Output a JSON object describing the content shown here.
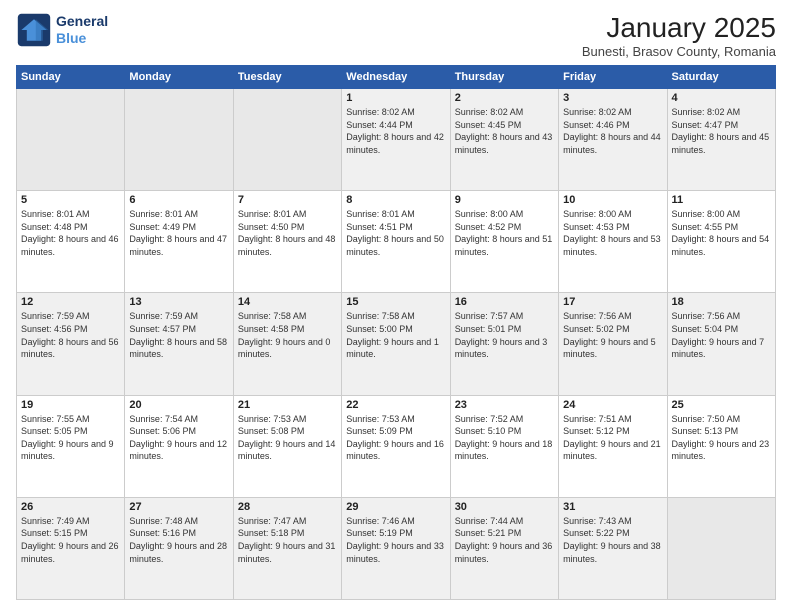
{
  "header": {
    "logo_line1": "General",
    "logo_line2": "Blue",
    "month": "January 2025",
    "location": "Bunesti, Brasov County, Romania"
  },
  "weekdays": [
    "Sunday",
    "Monday",
    "Tuesday",
    "Wednesday",
    "Thursday",
    "Friday",
    "Saturday"
  ],
  "weeks": [
    [
      {
        "day": "",
        "info": ""
      },
      {
        "day": "",
        "info": ""
      },
      {
        "day": "",
        "info": ""
      },
      {
        "day": "1",
        "info": "Sunrise: 8:02 AM\nSunset: 4:44 PM\nDaylight: 8 hours and 42 minutes."
      },
      {
        "day": "2",
        "info": "Sunrise: 8:02 AM\nSunset: 4:45 PM\nDaylight: 8 hours and 43 minutes."
      },
      {
        "day": "3",
        "info": "Sunrise: 8:02 AM\nSunset: 4:46 PM\nDaylight: 8 hours and 44 minutes."
      },
      {
        "day": "4",
        "info": "Sunrise: 8:02 AM\nSunset: 4:47 PM\nDaylight: 8 hours and 45 minutes."
      }
    ],
    [
      {
        "day": "5",
        "info": "Sunrise: 8:01 AM\nSunset: 4:48 PM\nDaylight: 8 hours and 46 minutes."
      },
      {
        "day": "6",
        "info": "Sunrise: 8:01 AM\nSunset: 4:49 PM\nDaylight: 8 hours and 47 minutes."
      },
      {
        "day": "7",
        "info": "Sunrise: 8:01 AM\nSunset: 4:50 PM\nDaylight: 8 hours and 48 minutes."
      },
      {
        "day": "8",
        "info": "Sunrise: 8:01 AM\nSunset: 4:51 PM\nDaylight: 8 hours and 50 minutes."
      },
      {
        "day": "9",
        "info": "Sunrise: 8:00 AM\nSunset: 4:52 PM\nDaylight: 8 hours and 51 minutes."
      },
      {
        "day": "10",
        "info": "Sunrise: 8:00 AM\nSunset: 4:53 PM\nDaylight: 8 hours and 53 minutes."
      },
      {
        "day": "11",
        "info": "Sunrise: 8:00 AM\nSunset: 4:55 PM\nDaylight: 8 hours and 54 minutes."
      }
    ],
    [
      {
        "day": "12",
        "info": "Sunrise: 7:59 AM\nSunset: 4:56 PM\nDaylight: 8 hours and 56 minutes."
      },
      {
        "day": "13",
        "info": "Sunrise: 7:59 AM\nSunset: 4:57 PM\nDaylight: 8 hours and 58 minutes."
      },
      {
        "day": "14",
        "info": "Sunrise: 7:58 AM\nSunset: 4:58 PM\nDaylight: 9 hours and 0 minutes."
      },
      {
        "day": "15",
        "info": "Sunrise: 7:58 AM\nSunset: 5:00 PM\nDaylight: 9 hours and 1 minute."
      },
      {
        "day": "16",
        "info": "Sunrise: 7:57 AM\nSunset: 5:01 PM\nDaylight: 9 hours and 3 minutes."
      },
      {
        "day": "17",
        "info": "Sunrise: 7:56 AM\nSunset: 5:02 PM\nDaylight: 9 hours and 5 minutes."
      },
      {
        "day": "18",
        "info": "Sunrise: 7:56 AM\nSunset: 5:04 PM\nDaylight: 9 hours and 7 minutes."
      }
    ],
    [
      {
        "day": "19",
        "info": "Sunrise: 7:55 AM\nSunset: 5:05 PM\nDaylight: 9 hours and 9 minutes."
      },
      {
        "day": "20",
        "info": "Sunrise: 7:54 AM\nSunset: 5:06 PM\nDaylight: 9 hours and 12 minutes."
      },
      {
        "day": "21",
        "info": "Sunrise: 7:53 AM\nSunset: 5:08 PM\nDaylight: 9 hours and 14 minutes."
      },
      {
        "day": "22",
        "info": "Sunrise: 7:53 AM\nSunset: 5:09 PM\nDaylight: 9 hours and 16 minutes."
      },
      {
        "day": "23",
        "info": "Sunrise: 7:52 AM\nSunset: 5:10 PM\nDaylight: 9 hours and 18 minutes."
      },
      {
        "day": "24",
        "info": "Sunrise: 7:51 AM\nSunset: 5:12 PM\nDaylight: 9 hours and 21 minutes."
      },
      {
        "day": "25",
        "info": "Sunrise: 7:50 AM\nSunset: 5:13 PM\nDaylight: 9 hours and 23 minutes."
      }
    ],
    [
      {
        "day": "26",
        "info": "Sunrise: 7:49 AM\nSunset: 5:15 PM\nDaylight: 9 hours and 26 minutes."
      },
      {
        "day": "27",
        "info": "Sunrise: 7:48 AM\nSunset: 5:16 PM\nDaylight: 9 hours and 28 minutes."
      },
      {
        "day": "28",
        "info": "Sunrise: 7:47 AM\nSunset: 5:18 PM\nDaylight: 9 hours and 31 minutes."
      },
      {
        "day": "29",
        "info": "Sunrise: 7:46 AM\nSunset: 5:19 PM\nDaylight: 9 hours and 33 minutes."
      },
      {
        "day": "30",
        "info": "Sunrise: 7:44 AM\nSunset: 5:21 PM\nDaylight: 9 hours and 36 minutes."
      },
      {
        "day": "31",
        "info": "Sunrise: 7:43 AM\nSunset: 5:22 PM\nDaylight: 9 hours and 38 minutes."
      },
      {
        "day": "",
        "info": ""
      }
    ]
  ]
}
